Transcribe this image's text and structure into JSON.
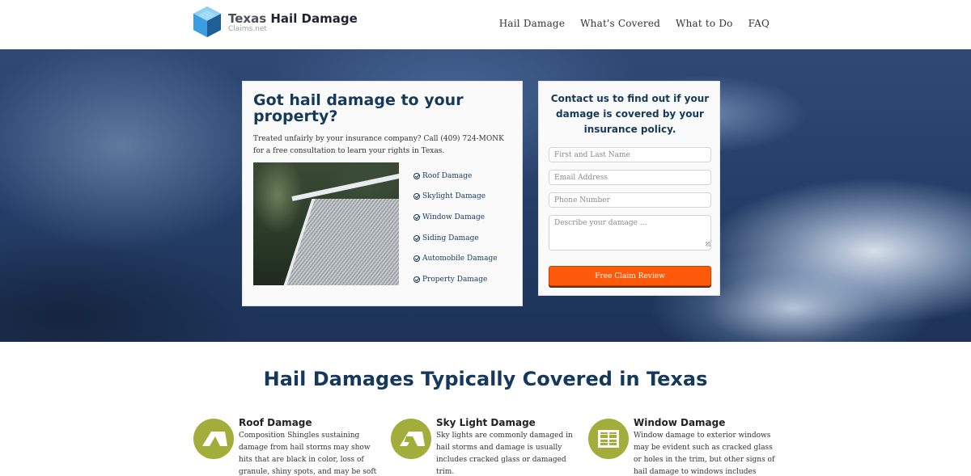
{
  "header": {
    "logo": {
      "title_part1": "Texas",
      "title_part2": "Hail Damage",
      "subtitle": "Claims.net"
    },
    "nav": [
      {
        "label": "Hail Damage"
      },
      {
        "label": "What's Covered"
      },
      {
        "label": "What to Do"
      },
      {
        "label": "FAQ"
      }
    ]
  },
  "hero": {
    "left_card": {
      "heading": "Got hail damage to your property?",
      "intro": "Treated unfairly by your insurance company? Call (409) 724-MONK for a free consultation to learn your rights in Texas.",
      "damage_types": [
        {
          "label": "Roof Damage"
        },
        {
          "label": "Skylight Damage"
        },
        {
          "label": "Window Damage"
        },
        {
          "label": "Siding Damage"
        },
        {
          "label": "Automobile Damage"
        },
        {
          "label": "Property Damage"
        }
      ]
    },
    "form": {
      "heading": "Contact us to find out if your damage is covered by your insurance policy.",
      "name_placeholder": "First and Last Name",
      "email_placeholder": "Email Address",
      "phone_placeholder": "Phone Number",
      "description_placeholder": "Describe your damage ...",
      "submit_label": "Free Claim Review"
    }
  },
  "coverage": {
    "title": "Hail Damages Typically Covered in Texas",
    "items": [
      {
        "title": "Roof Damage",
        "text": "Composition Shingles sustaining damage from hail storms may show hits that are black in color, loss of granule, shiny spots, and may be soft to the",
        "icon": "roof-icon"
      },
      {
        "title": "Sky Light Damage",
        "text": "Sky lights are commonly damaged in hail storms and damage is usually includes cracked glass or damaged trim.",
        "icon": "skylight-icon"
      },
      {
        "title": "Window Damage",
        "text": "Window damage to exterior windows may be evident such as cracked glass or holes in the trim, but other signs of hail damage to windows includes small",
        "icon": "window-icon"
      }
    ]
  },
  "colors": {
    "brand_navy": "#14395c",
    "accent_orange": "#ff5a0a",
    "icon_green": "#a2ad3c"
  }
}
